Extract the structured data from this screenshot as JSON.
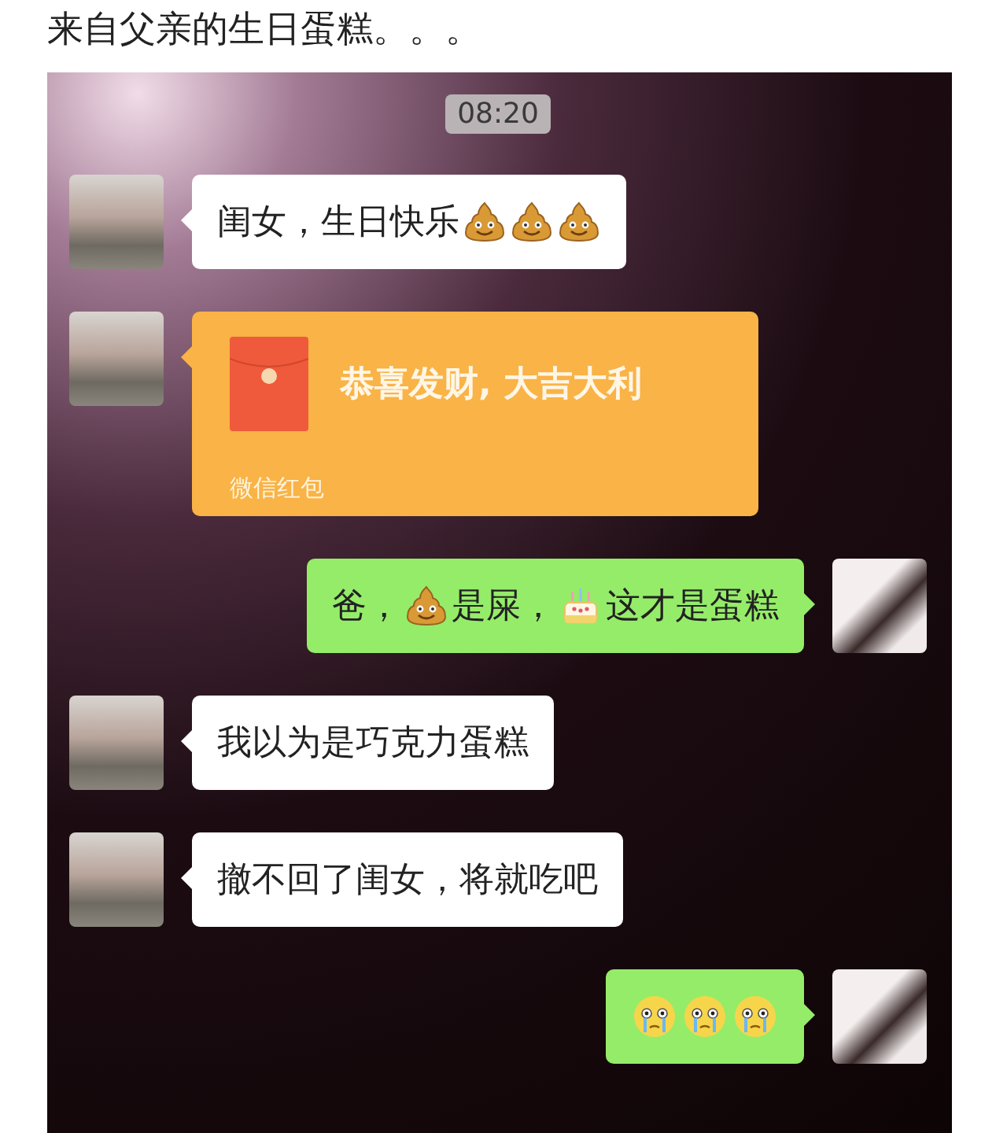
{
  "post": {
    "title": "来自父亲的生日蛋糕。。。"
  },
  "chat": {
    "timestamp": "08:20",
    "messages": [
      {
        "kind": "received_text",
        "parts": [
          {
            "kind": "text",
            "text": "闺女，生日快乐"
          },
          {
            "kind": "poop_emoji"
          },
          {
            "kind": "poop_emoji"
          },
          {
            "kind": "poop_emoji"
          }
        ]
      },
      {
        "kind": "received_gift",
        "greeting": "恭喜发财, 大吉大利",
        "label": "微信红包"
      },
      {
        "kind": "sent_text",
        "parts": [
          {
            "kind": "text",
            "text": "爸，"
          },
          {
            "kind": "poop_emoji"
          },
          {
            "kind": "text",
            "text": "是屎，"
          },
          {
            "kind": "cake_emoji"
          },
          {
            "kind": "text",
            "text": "这才是蛋糕"
          }
        ]
      },
      {
        "kind": "received_text",
        "parts": [
          {
            "kind": "text",
            "text": "我以为是巧克力蛋糕"
          }
        ]
      },
      {
        "kind": "received_text",
        "parts": [
          {
            "kind": "text",
            "text": "撤不回了闺女，将就吃吧"
          }
        ]
      },
      {
        "kind": "sent_text",
        "parts": [
          {
            "kind": "crying_emoji"
          },
          {
            "kind": "crying_emoji"
          },
          {
            "kind": "crying_emoji"
          }
        ]
      }
    ]
  }
}
